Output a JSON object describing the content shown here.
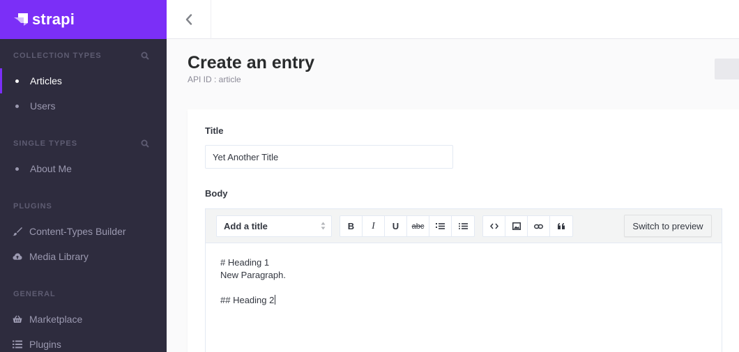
{
  "brand": {
    "name": "strapi"
  },
  "sidebar": {
    "collection_types": {
      "title": "COLLECTION TYPES",
      "items": [
        {
          "label": "Articles"
        },
        {
          "label": "Users"
        }
      ]
    },
    "single_types": {
      "title": "SINGLE TYPES",
      "items": [
        {
          "label": "About Me"
        }
      ]
    },
    "plugins": {
      "title": "PLUGINS",
      "items": [
        {
          "label": "Content-Types Builder",
          "icon": "paintbrush-icon"
        },
        {
          "label": "Media Library",
          "icon": "cloud-upload-icon"
        }
      ]
    },
    "general": {
      "title": "GENERAL",
      "items": [
        {
          "label": "Marketplace",
          "icon": "basket-icon"
        },
        {
          "label": "Plugins",
          "icon": "list-icon"
        }
      ]
    }
  },
  "header": {
    "back_icon": "chevron-left-icon"
  },
  "page": {
    "title": "Create an entry",
    "subtitle": "API ID : article"
  },
  "form": {
    "title_label": "Title",
    "title_value": "Yet Another Title",
    "body_label": "Body",
    "editor": {
      "heading_select": "Add a title",
      "buttons_format": [
        "B",
        "I",
        "U",
        "abc"
      ],
      "switch_label": "Switch to preview",
      "content_lines": [
        "# Heading 1",
        "New Paragraph.",
        "",
        "## Heading 2"
      ]
    }
  },
  "colors": {
    "accent": "#7b2ff7",
    "sidebar_bg": "#2e2c3e"
  }
}
